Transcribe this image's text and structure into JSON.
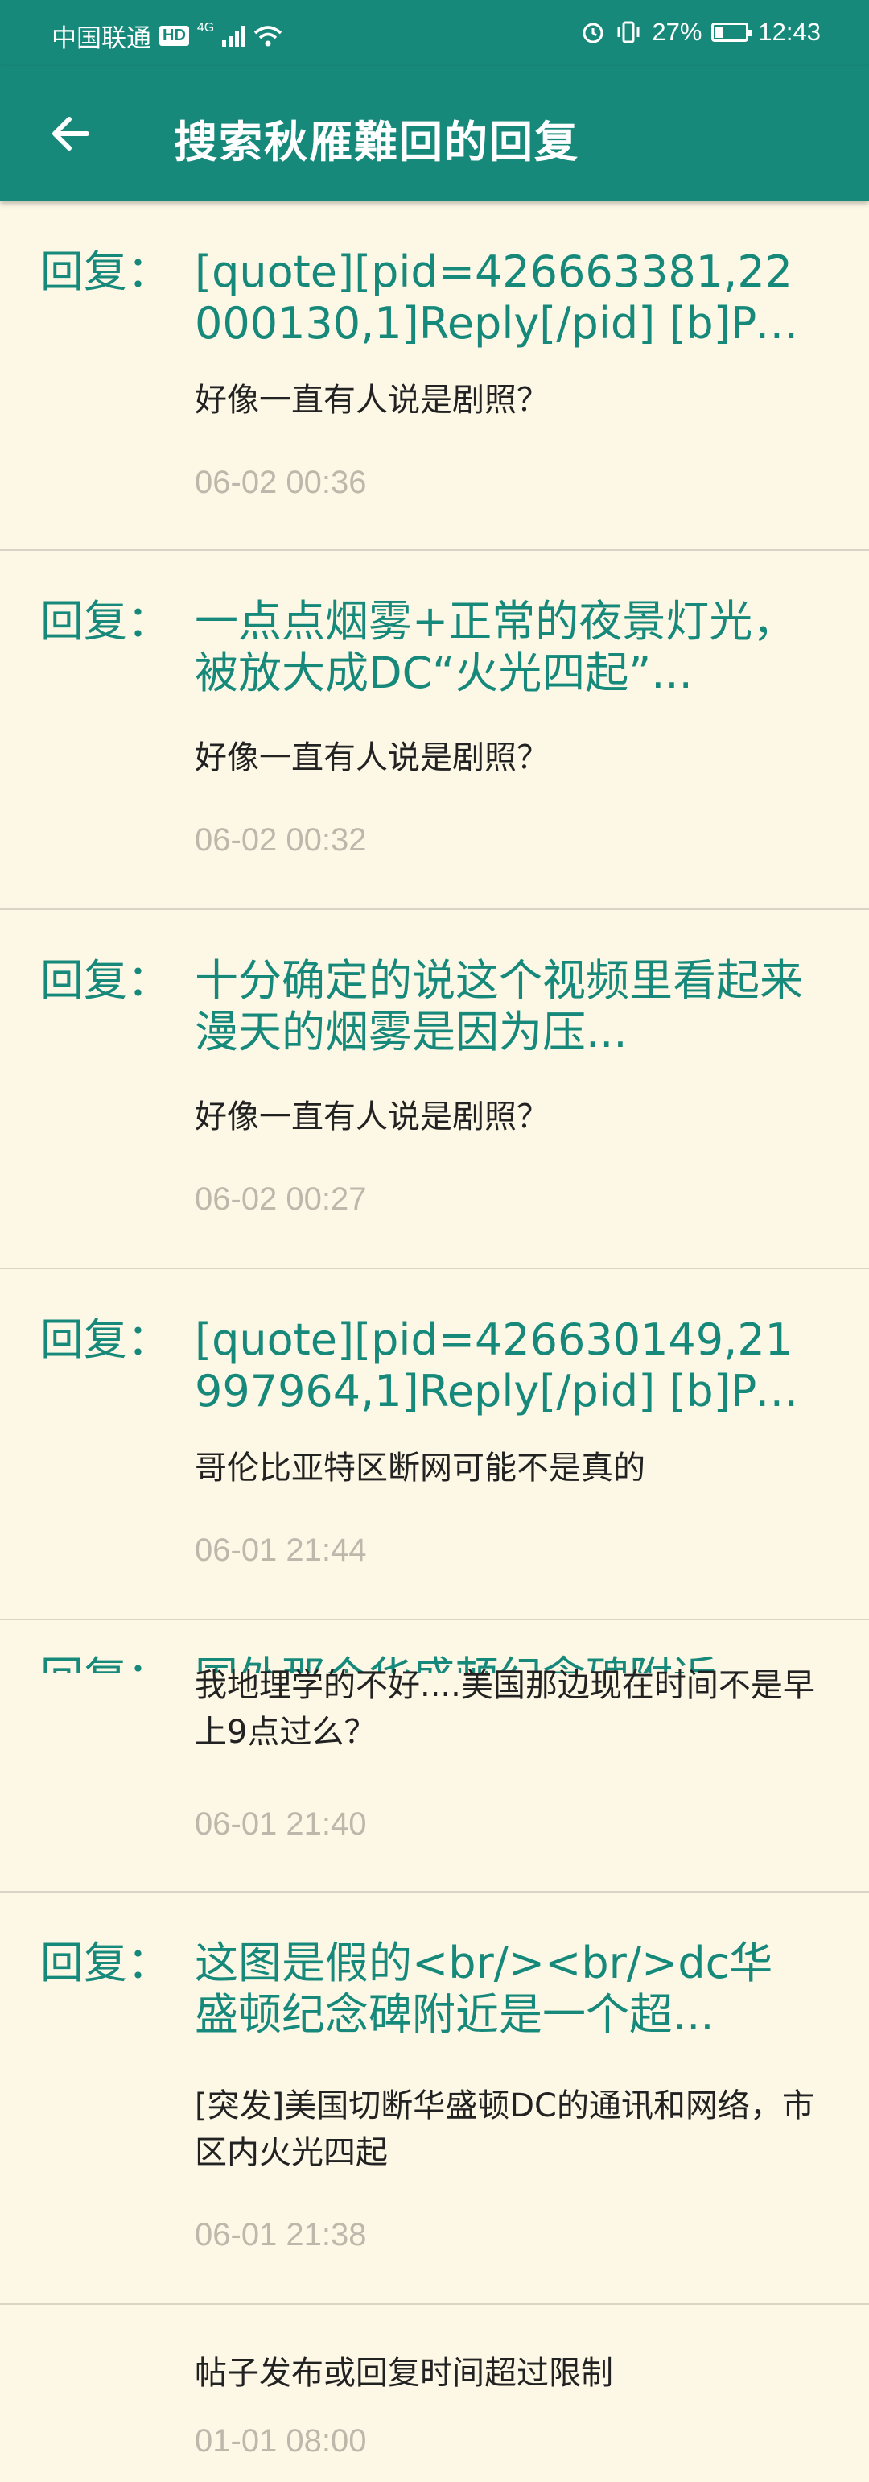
{
  "status_bar": {
    "carrier": "中国联通",
    "hd": "HD",
    "network": "4G",
    "battery_percent": "27%",
    "battery_level": 0.27,
    "time": "12:43"
  },
  "appbar": {
    "title": "搜索秋雁難回的回复"
  },
  "reply_prefix": "回复：",
  "items": [
    {
      "title": "[quote][pid=426663381,22000130,1]Reply[/pid] [b]Post by [uid=...",
      "content": "好像一直有人说是剧照？",
      "time": "06-02 00:36"
    },
    {
      "title": "一点点烟雾+正常的夜景灯光，被放大成DC“火光四起”...",
      "content": "好像一直有人说是剧照？",
      "time": "06-02 00:32"
    },
    {
      "title": "十分确定的说这个视频里看起来漫天的烟雾是因为压...",
      "content": "好像一直有人说是剧照？",
      "time": "06-02 00:27"
    },
    {
      "title": "[quote][pid=426630149,21997964,1]Reply[/pid] [b]Post by [uid=...",
      "content": "哥伦比亚特区断网可能不是真的",
      "time": "06-01 21:44"
    },
    {
      "title": "国外那个华盛顿纪念碑附近",
      "content": "我地理学的不好....美国那边现在时间不是早上9点过么？",
      "time": "06-01 21:40"
    },
    {
      "title": "这图是假的<br/><br/>dc华盛顿纪念碑附近是一个超...",
      "content": "[突发]美国切断华盛顿DC的通讯和网络，市区内火光四起",
      "time": "06-01 21:38"
    },
    {
      "title": "",
      "content": "帖子发布或回复时间超过限制",
      "time": "01-01 08:00"
    }
  ]
}
